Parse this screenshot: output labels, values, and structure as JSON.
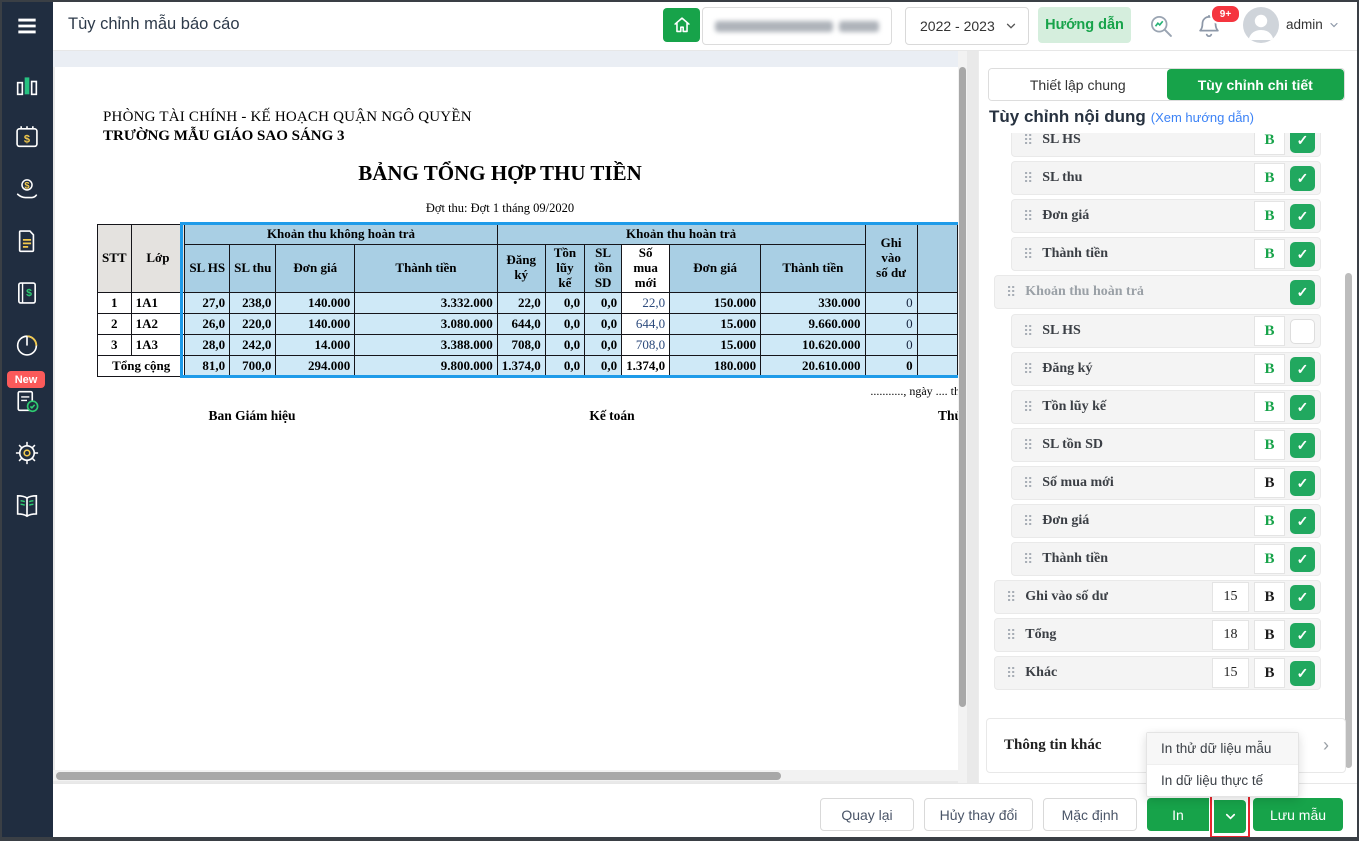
{
  "colors": {
    "accent_green": "#17a34a",
    "selection_blue": "#1e9be9",
    "link_blue": "#3b82f6",
    "badge_red": "#f5353f",
    "sidebar_navy": "#202d40"
  },
  "header": {
    "title": "Tùy chỉnh mẫu báo cáo",
    "year_selector": "2022 - 2023",
    "guide_button": "Hướng dẫn",
    "notification_badge": "9+",
    "user_name": "admin"
  },
  "sidebar": {
    "new_badge": "New"
  },
  "report": {
    "org_line1": "PHÒNG TÀI CHÍNH - KẾ HOẠCH QUẬN NGÔ QUYỀN",
    "org_line2": "TRƯỜNG MẪU GIÁO SAO SÁNG 3",
    "title": "BẢNG TỔNG HỢP THU TIỀN",
    "subtitle": "Đợt thu: Đợt 1 tháng 09/2020",
    "date_line": "..........., ngày .... th",
    "sign1": "Ban Giám hiệu",
    "sign2": "Kế toán",
    "sign3": "Thủ",
    "table": {
      "stt": "STT",
      "lop": "Lớp",
      "group1": "Khoản thu không hoàn trả",
      "group2": "Khoản thu hoàn trả",
      "ghi_vao": "Ghi vào\nsố dư",
      "cols": [
        "SL HS",
        "SL thu",
        "Đơn giá",
        "Thành tiền",
        "Đăng\nký",
        "Tồn\nlũy kế",
        "SL tồn\nSD",
        "Số mua\nmới",
        "Đơn giá",
        "Thành tiền"
      ],
      "rows": [
        [
          "1",
          "1A1",
          "27,0",
          "238,0",
          "140.000",
          "3.332.000",
          "22,0",
          "0,0",
          "0,0",
          "22,0",
          "150.000",
          "330.000",
          "0"
        ],
        [
          "2",
          "1A2",
          "26,0",
          "220,0",
          "140.000",
          "3.080.000",
          "644,0",
          "0,0",
          "0,0",
          "644,0",
          "15.000",
          "9.660.000",
          "0"
        ],
        [
          "3",
          "1A3",
          "28,0",
          "242,0",
          "14.000",
          "3.388.000",
          "708,0",
          "0,0",
          "0,0",
          "708,0",
          "15.000",
          "10.620.000",
          "0"
        ]
      ],
      "totals": [
        "Tổng cộng",
        "81,0",
        "700,0",
        "294.000",
        "9.800.000",
        "1.374,0",
        "0,0",
        "0,0",
        "1.374,0",
        "180.000",
        "20.610.000",
        "0"
      ]
    }
  },
  "panel": {
    "tabs": [
      {
        "label": "Thiết lập chung"
      },
      {
        "label": "Tùy chỉnh chi tiết"
      }
    ],
    "heading": "Tùy chỉnh nội dung",
    "heading_link": "(Xem hướng dẫn)",
    "b_label": "B",
    "items": [
      {
        "label": "SL HS",
        "level": "sub",
        "b_dark": false,
        "checked": true
      },
      {
        "label": "SL thu",
        "level": "sub",
        "b_dark": false,
        "checked": true
      },
      {
        "label": "Đơn giá",
        "level": "sub",
        "b_dark": false,
        "checked": true
      },
      {
        "label": "Thành tiền",
        "level": "sub",
        "b_dark": false,
        "checked": true
      },
      {
        "label": "Khoản thu hoàn trả",
        "level": "group",
        "checked": true
      },
      {
        "label": "SL HS",
        "level": "sub",
        "b_dark": false,
        "checked": false
      },
      {
        "label": "Đăng ký",
        "level": "sub",
        "b_dark": false,
        "checked": true
      },
      {
        "label": "Tồn lũy kế",
        "level": "sub",
        "b_dark": false,
        "checked": true
      },
      {
        "label": "SL tồn SD",
        "level": "sub",
        "b_dark": false,
        "checked": true
      },
      {
        "label": "Số mua mới",
        "level": "sub",
        "b_dark": true,
        "checked": true
      },
      {
        "label": "Đơn giá",
        "level": "sub",
        "b_dark": false,
        "checked": true
      },
      {
        "label": "Thành tiền",
        "level": "sub",
        "b_dark": false,
        "checked": true
      },
      {
        "label": "Ghi vào số dư",
        "level": "group",
        "size": "15",
        "b_dark": true,
        "checked": true
      },
      {
        "label": "Tổng",
        "level": "group",
        "size": "18",
        "b_dark": true,
        "checked": true
      },
      {
        "label": "Khác",
        "level": "group",
        "size": "15",
        "b_dark": true,
        "checked": true
      }
    ],
    "other_info": "Thông tin khác"
  },
  "print_menu": {
    "items": [
      "In thử dữ liệu mẫu",
      "In dữ liệu thực tế"
    ]
  },
  "footer": {
    "back": "Quay lại",
    "cancel": "Hủy thay đổi",
    "default": "Mặc định",
    "print": "In",
    "save": "Lưu mẫu"
  }
}
